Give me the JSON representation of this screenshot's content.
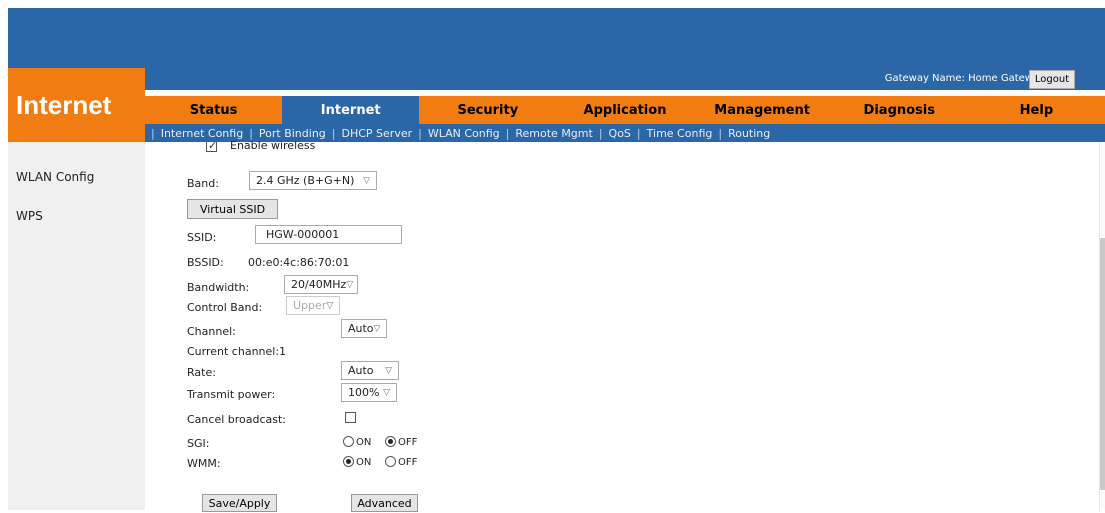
{
  "brand": "Internet",
  "header": {
    "gateway_name": "Gateway Name: Home Gateway",
    "logout": "Logout"
  },
  "tabs": [
    {
      "label": "Status"
    },
    {
      "label": "Internet"
    },
    {
      "label": "Security"
    },
    {
      "label": "Application"
    },
    {
      "label": "Management"
    },
    {
      "label": "Diagnosis"
    },
    {
      "label": "Help"
    }
  ],
  "active_tab": "Internet",
  "subnav": [
    "Internet Config",
    "Port Binding",
    "DHCP Server",
    "WLAN Config",
    "Remote Mgmt",
    "QoS",
    "Time Config",
    "Routing"
  ],
  "sidebar": [
    "WLAN Config",
    "WPS"
  ],
  "form": {
    "enable_wireless": "Enable wireless",
    "band_label": "Band:",
    "band_value": "2.4 GHz (B+G+N)",
    "virtual_ssid": "Virtual SSID",
    "ssid_label": "SSID:",
    "ssid_value": "HGW-000001",
    "bssid_label": "BSSID:",
    "bssid_value": "00:e0:4c:86:70:01",
    "bandwidth_label": "Bandwidth:",
    "bandwidth_value": "20/40MHz",
    "control_band_label": "Control Band:",
    "control_band_value": "Upper",
    "channel_label": "Channel:",
    "channel_value": "Auto",
    "current_channel": "Current channel:1",
    "rate_label": "Rate:",
    "rate_value": "Auto",
    "power_label": "Transmit power:",
    "power_value": "100%",
    "cancel_broadcast_label": "Cancel broadcast:",
    "sgi_label": "SGI:",
    "wmm_label": "WMM:",
    "on": "ON",
    "off": "OFF",
    "save": "Save/Apply",
    "advanced": "Advanced"
  },
  "colors": {
    "blue": "#2b66a6",
    "orange": "#f07c12"
  }
}
